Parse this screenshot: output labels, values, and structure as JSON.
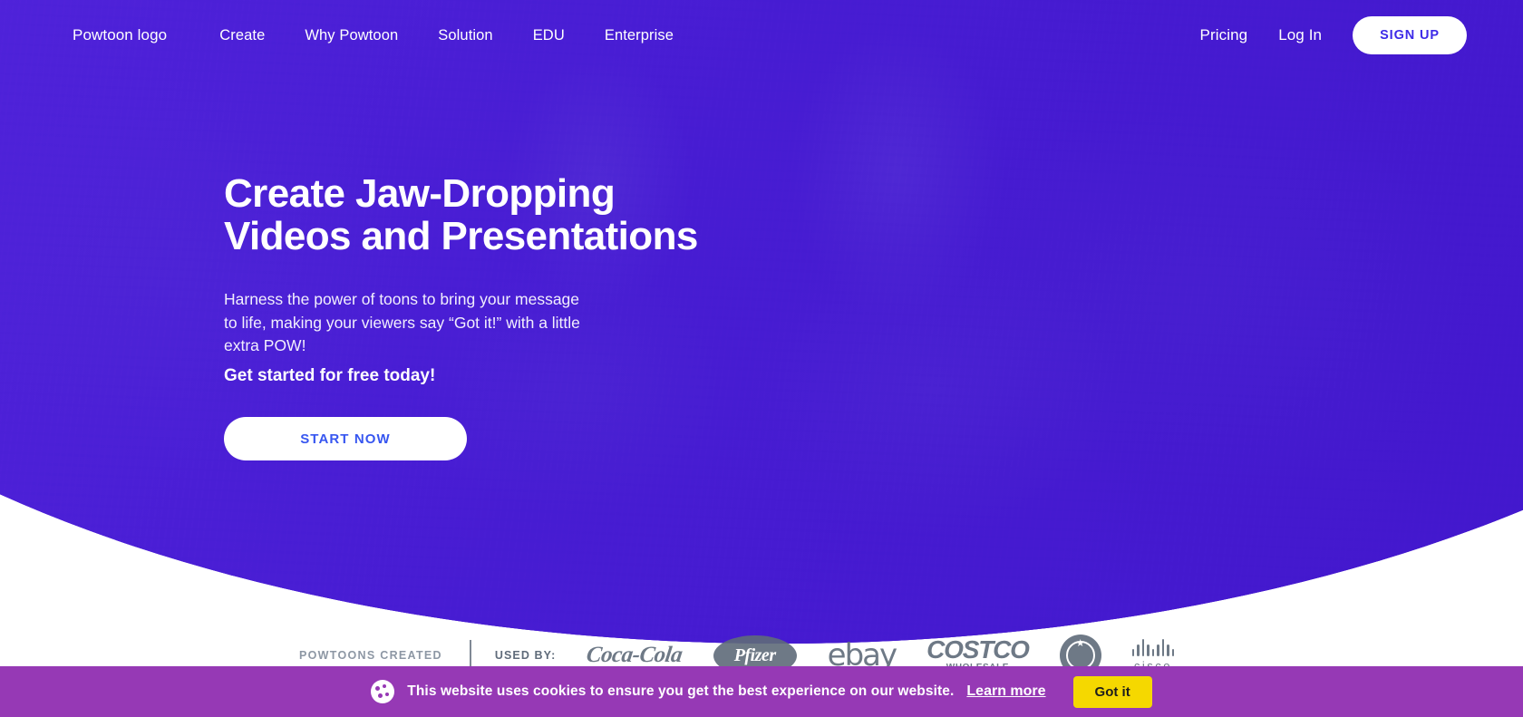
{
  "nav": {
    "brand": "Powtoon logo",
    "links": [
      {
        "label": "Create"
      },
      {
        "label": "Why Powtoon"
      },
      {
        "label": "Solution"
      },
      {
        "label": "EDU"
      },
      {
        "label": "Enterprise"
      }
    ],
    "pricing": "Pricing",
    "login": "Log In",
    "signup": "SIGN UP"
  },
  "hero": {
    "headline": "Create Jaw-Dropping\nVideos and Presentations",
    "subcopy": "Harness the power of toons to bring your message\nto life, making your viewers say “Got it!” with a little\nextra POW!",
    "subcopy_strong": "Get started for free today!",
    "cta": "START NOW"
  },
  "proof": {
    "stat_label": "POWTOONS\nCREATED",
    "used_by": "USED BY:",
    "logos": [
      {
        "name": "coca-cola",
        "text": "Coca-Cola"
      },
      {
        "name": "pfizer",
        "text": "Pfizer"
      },
      {
        "name": "ebay",
        "text": "ebay"
      },
      {
        "name": "costco",
        "text": "COSTCO",
        "sub": "WHOLESALE"
      },
      {
        "name": "starbucks",
        "text": ""
      },
      {
        "name": "cisco",
        "text": "cisco"
      }
    ]
  },
  "cookie": {
    "message": "This website uses cookies to ensure you get the best experience on our website.",
    "link": "Learn more",
    "accept": "Got it"
  },
  "colors": {
    "hero_purple": "#4A1FD6",
    "cookie_purple": "#9639B5",
    "accent_yellow": "#F5D800",
    "cta_blue": "#3756F0"
  }
}
